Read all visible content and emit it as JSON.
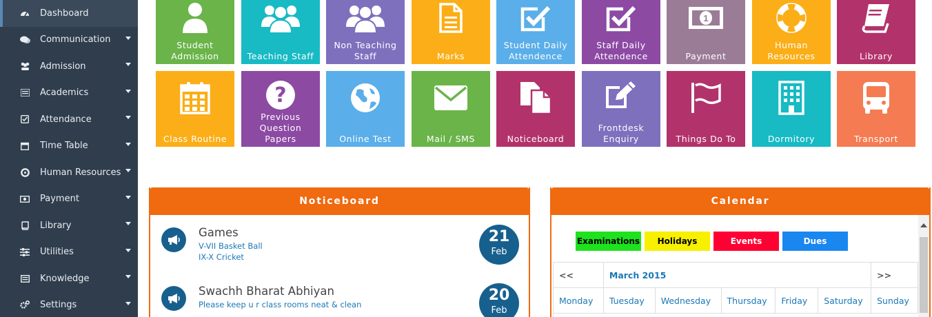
{
  "sidebar": {
    "items": [
      {
        "label": "Dashboard",
        "icon": "dashboard-icon",
        "active": true,
        "has_submenu": false
      },
      {
        "label": "Communication",
        "icon": "comments-icon",
        "has_submenu": true
      },
      {
        "label": "Admission",
        "icon": "users-icon",
        "has_submenu": true
      },
      {
        "label": "Academics",
        "icon": "list-icon",
        "has_submenu": true
      },
      {
        "label": "Attendance",
        "icon": "checkbox-icon",
        "has_submenu": true
      },
      {
        "label": "Time Table",
        "icon": "calendar-icon",
        "has_submenu": true
      },
      {
        "label": "Human Resources",
        "icon": "lifebuoy-icon",
        "has_submenu": true
      },
      {
        "label": "Payment",
        "icon": "money-icon",
        "has_submenu": true
      },
      {
        "label": "Library",
        "icon": "book-icon",
        "has_submenu": true
      },
      {
        "label": "Utilities",
        "icon": "sliders-icon",
        "has_submenu": true
      },
      {
        "label": "Knowledge",
        "icon": "newspaper-icon",
        "has_submenu": true
      },
      {
        "label": "Settings",
        "icon": "cogs-icon",
        "has_submenu": true
      }
    ]
  },
  "tiles": {
    "row1": [
      {
        "label": "Student\nAdmission",
        "icon": "user-icon",
        "color": "#6ab44a"
      },
      {
        "label": "Teaching Staff",
        "icon": "group-icon",
        "color": "#18bac4"
      },
      {
        "label": "Non Teaching\nStaff",
        "icon": "group-icon",
        "color": "#7e70bd"
      },
      {
        "label": "Marks",
        "icon": "document-icon",
        "color": "#fbae17"
      },
      {
        "label": "Student Daily\nAttendence",
        "icon": "checkbox-icon",
        "color": "#5aaee9"
      },
      {
        "label": "Staff Daily\nAttendence",
        "icon": "checkbox-icon",
        "color": "#8c4aa3"
      },
      {
        "label": "Payment",
        "icon": "banknote-icon",
        "color": "#9b7c97"
      },
      {
        "label": "Human\nResources",
        "icon": "lifebuoy-icon",
        "color": "#fbae17"
      },
      {
        "label": "Library",
        "icon": "book-icon",
        "color": "#b2336b"
      }
    ],
    "row2": [
      {
        "label": "Class Routine",
        "icon": "calendar-icon",
        "color": "#fbae17"
      },
      {
        "label": "Previous\nQuestion\nPapers",
        "icon": "question-icon",
        "color": "#8c4aa3"
      },
      {
        "label": "Online Test",
        "icon": "globe-icon",
        "color": "#5aaee9"
      },
      {
        "label": "Mail / SMS",
        "icon": "envelope-icon",
        "color": "#6ab44a"
      },
      {
        "label": "Noticeboard",
        "icon": "copy-icon",
        "color": "#b2336b"
      },
      {
        "label": "Frontdesk\nEnquiry",
        "icon": "edit-icon",
        "color": "#7e70bd"
      },
      {
        "label": "Things Do To",
        "icon": "flag-icon",
        "color": "#b2336b"
      },
      {
        "label": "Dormitory",
        "icon": "building-icon",
        "color": "#18bac4"
      },
      {
        "label": "Transport",
        "icon": "bus-icon",
        "color": "#f57b52"
      }
    ]
  },
  "noticeboard": {
    "title": "Noticeboard",
    "items": [
      {
        "title": "Games",
        "lines": [
          "V-VII Basket Ball",
          "IX-X Cricket"
        ],
        "day": "21",
        "month": "Feb"
      },
      {
        "title": "Swachh Bharat Abhiyan",
        "lines": [
          "Please keep u r class rooms neat & clean"
        ],
        "day": "20",
        "month": "Feb"
      }
    ]
  },
  "calendar": {
    "title": "Calendar",
    "legend": [
      {
        "label": "Examinations",
        "color": "#1de21d",
        "text_color": "#000000"
      },
      {
        "label": "Holidays",
        "color": "#f7f000",
        "text_color": "#000000"
      },
      {
        "label": "Events",
        "color": "#ff0033",
        "text_color": "#ffffff"
      },
      {
        "label": "Dues",
        "color": "#1a86f0",
        "text_color": "#ffffff"
      }
    ],
    "prev": "<<",
    "next": ">>",
    "month": "March 2015",
    "weekdays": [
      "Monday",
      "Tuesday",
      "Wednesday",
      "Thursday",
      "Friday",
      "Saturday",
      "Sunday"
    ]
  },
  "colors": {
    "accent": "#f06a0f",
    "sidebar_bg": "#2f3d4c",
    "badge_bg": "#17608e"
  }
}
